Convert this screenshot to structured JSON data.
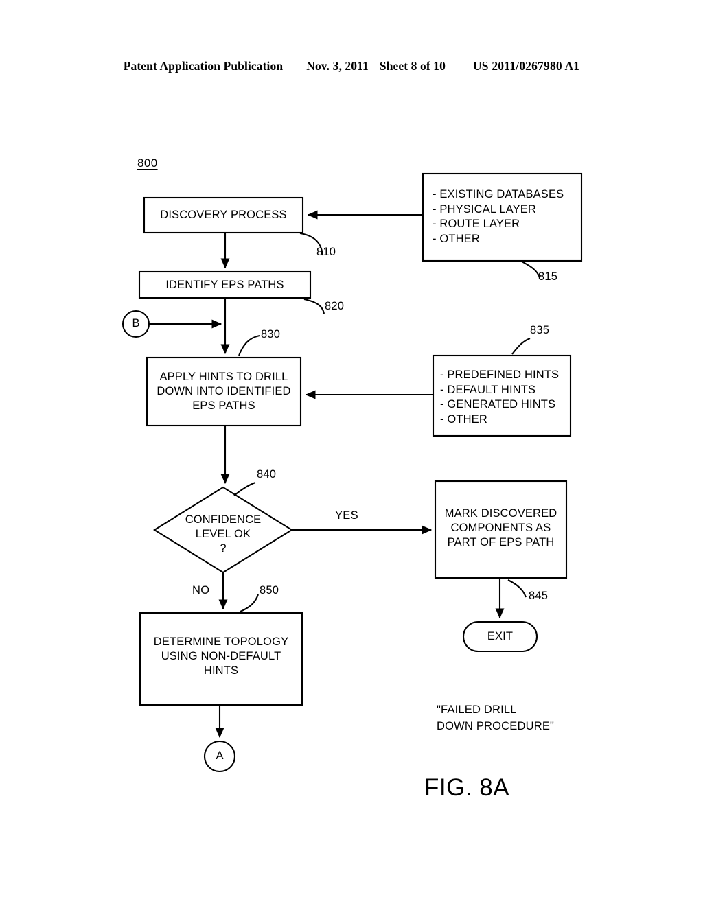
{
  "page_header": {
    "publication": "Patent Application Publication",
    "date": "Nov. 3, 2011",
    "sheet": "Sheet 8 of 10",
    "patent_number": "US 2011/0267980 A1"
  },
  "figure": {
    "diagram_id": "800",
    "caption": "FIG. 8A",
    "note": "\"FAILED DRILL\n  DOWN PROCEDURE\""
  },
  "nodes": {
    "discovery_process": {
      "label": "DISCOVERY PROCESS",
      "ref": "810",
      "shape": "rectangle"
    },
    "existing_databases": {
      "label": "- EXISTING DATABASES\n- PHYSICAL LAYER\n- ROUTE LAYER\n- OTHER",
      "ref": "815",
      "shape": "rectangle",
      "items": [
        "- EXISTING DATABASES",
        "- PHYSICAL LAYER",
        "- ROUTE LAYER",
        "- OTHER"
      ]
    },
    "identify_eps_paths": {
      "label": "IDENTIFY EPS PATHS",
      "ref": "820",
      "shape": "rectangle"
    },
    "connector_b": {
      "label": "B",
      "shape": "circle"
    },
    "apply_hints": {
      "label": "APPLY HINTS TO DRILL\nDOWN INTO IDENTIFIED\nEPS PATHS",
      "ref": "830",
      "shape": "rectangle"
    },
    "hints_sources": {
      "label": "- PREDEFINED HINTS\n- DEFAULT HINTS\n- GENERATED HINTS\n- OTHER",
      "ref": "835",
      "shape": "rectangle",
      "items": [
        "- PREDEFINED HINTS",
        "- DEFAULT HINTS",
        "- GENERATED HINTS",
        "- OTHER"
      ]
    },
    "confidence_decision": {
      "label": "CONFIDENCE\nLEVEL OK\n?",
      "ref": "840",
      "shape": "diamond"
    },
    "mark_components": {
      "label": "MARK DISCOVERED\nCOMPONENTS AS\nPART OF EPS PATH",
      "ref": "845",
      "shape": "rectangle"
    },
    "exit_terminal": {
      "label": "EXIT",
      "shape": "stadium"
    },
    "determine_topology": {
      "label": "DETERMINE TOPOLOGY\nUSING NON-DEFAULT\nHINTS",
      "ref": "850",
      "shape": "rectangle"
    },
    "connector_a": {
      "label": "A",
      "shape": "circle"
    }
  },
  "edge_labels": {
    "yes": "YES",
    "no": "NO"
  },
  "colors": {
    "ink": "#000000",
    "paper": "#ffffff"
  }
}
